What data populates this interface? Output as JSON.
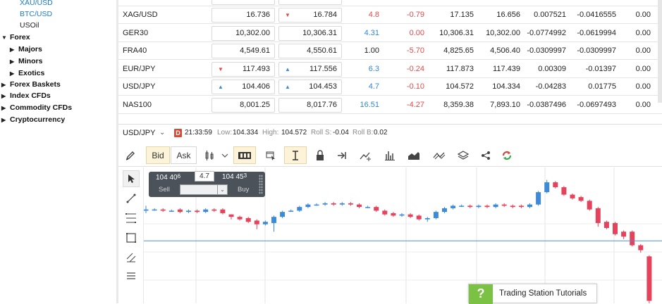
{
  "tree": {
    "leaves_top": [
      {
        "label": "XAU/USD",
        "blue": true
      },
      {
        "label": "BTC/USD",
        "blue": true
      },
      {
        "label": "USOil",
        "blue": false
      }
    ],
    "groups": [
      {
        "label": "Forex",
        "expanded": true,
        "level": 0
      },
      {
        "label": "Majors",
        "expanded": false,
        "level": 1
      },
      {
        "label": "Minors",
        "expanded": false,
        "level": 1
      },
      {
        "label": "Exotics",
        "expanded": false,
        "level": 1
      },
      {
        "label": "Forex Baskets",
        "expanded": false,
        "level": 0
      },
      {
        "label": "Index CFDs",
        "expanded": false,
        "level": 0
      },
      {
        "label": "Commodity CFDs",
        "expanded": false,
        "level": 0
      },
      {
        "label": "Cryptocurrency",
        "expanded": false,
        "level": 0
      }
    ]
  },
  "quotes": {
    "rows": [
      {
        "symbol": "XAG/USD",
        "sell": "16.736",
        "buy": "16.784",
        "sell_arrow": "",
        "buy_arrow": "down",
        "spread": "4.8",
        "spread_color": "neg",
        "change": "-0.79",
        "change_color": "neg",
        "high": "17.135",
        "low": "16.656",
        "c1": "0.007521",
        "c2": "-0.0416555",
        "c3": "0.00"
      },
      {
        "symbol": "GER30",
        "sell": "10,302.00",
        "buy": "10,306.31",
        "sell_arrow": "",
        "buy_arrow": "",
        "spread": "4.31",
        "spread_color": "pos",
        "change": "0.00",
        "change_color": "neg",
        "high": "10,306.31",
        "low": "10,302.00",
        "c1": "-0.0774992",
        "c2": "-0.0619994",
        "c3": "0.00"
      },
      {
        "symbol": "FRA40",
        "sell": "4,549.61",
        "buy": "4,550.61",
        "sell_arrow": "",
        "buy_arrow": "",
        "spread": "1.00",
        "spread_color": "blk",
        "change": "-5.70",
        "change_color": "neg",
        "high": "4,825.65",
        "low": "4,506.40",
        "c1": "-0.0309997",
        "c2": "-0.0309997",
        "c3": "0.00"
      },
      {
        "symbol": "EUR/JPY",
        "sell": "117.493",
        "buy": "117.556",
        "sell_arrow": "down",
        "buy_arrow": "up",
        "spread": "6.3",
        "spread_color": "pos",
        "change": "-0.24",
        "change_color": "neg",
        "high": "117.873",
        "low": "117.439",
        "c1": "0.00309",
        "c2": "-0.01397",
        "c3": "0.00"
      },
      {
        "symbol": "USD/JPY",
        "sell": "104.406",
        "buy": "104.453",
        "sell_arrow": "up",
        "buy_arrow": "up",
        "spread": "4.7",
        "spread_color": "pos",
        "change": "-0.10",
        "change_color": "neg",
        "high": "104.572",
        "low": "104.334",
        "c1": "-0.04283",
        "c2": "0.01775",
        "c3": "0.00"
      },
      {
        "symbol": "NAS100",
        "sell": "8,001.25",
        "buy": "8,017.76",
        "sell_arrow": "",
        "buy_arrow": "",
        "spread": "16.51",
        "spread_color": "pos",
        "change": "-4.27",
        "change_color": "neg",
        "high": "8,359.38",
        "low": "7,893.10",
        "c1": "-0.0387496",
        "c2": "-0.0697493",
        "c3": "0.00"
      }
    ]
  },
  "chart_header": {
    "symbol": "USD/JPY",
    "badge": "D",
    "time": "21:33:59",
    "low_label": "Low:",
    "low": "104.334",
    "high_label": "High:",
    "high": "104.572",
    "rolls_label": "Roll S:",
    "rolls": "-0.04",
    "rollb_label": "Roll B:",
    "rollb": "0.02"
  },
  "toolbar": {
    "bid_label": "Bid",
    "ask_label": "Ask"
  },
  "trade_widget": {
    "sell_main": "104 40",
    "sell_sup": "6",
    "sell_label": "Sell",
    "buy_main": "104 45",
    "buy_sup": "3",
    "buy_label": "Buy",
    "spread": "4.7"
  },
  "tutorial": {
    "icon": "?",
    "label": "Trading Station Tutorials"
  },
  "colors": {
    "up_candle": "#3d8bd8",
    "down_candle": "#e5425b",
    "accent_green": "#7bc144",
    "badge_red": "#d94a36"
  },
  "chart_data": {
    "type": "candlestick",
    "symbol": "USD/JPY",
    "ylim": [
      103.9,
      105.0
    ],
    "candles": [
      {
        "o": 104.65,
        "c": 104.66,
        "h": 104.69,
        "l": 104.63
      },
      {
        "o": 104.66,
        "c": 104.66,
        "h": 104.67,
        "l": 104.65
      },
      {
        "o": 104.66,
        "c": 104.65,
        "h": 104.67,
        "l": 104.64
      },
      {
        "o": 104.65,
        "c": 104.65,
        "h": 104.66,
        "l": 104.64
      },
      {
        "o": 104.66,
        "c": 104.64,
        "h": 104.67,
        "l": 104.63
      },
      {
        "o": 104.64,
        "c": 104.65,
        "h": 104.66,
        "l": 104.63
      },
      {
        "o": 104.65,
        "c": 104.64,
        "h": 104.66,
        "l": 104.63
      },
      {
        "o": 104.64,
        "c": 104.66,
        "h": 104.67,
        "l": 104.63
      },
      {
        "o": 104.66,
        "c": 104.65,
        "h": 104.67,
        "l": 104.64
      },
      {
        "o": 104.66,
        "c": 104.63,
        "h": 104.67,
        "l": 104.62
      },
      {
        "o": 104.62,
        "c": 104.6,
        "h": 104.62,
        "l": 104.58
      },
      {
        "o": 104.6,
        "c": 104.58,
        "h": 104.61,
        "l": 104.57
      },
      {
        "o": 104.59,
        "c": 104.56,
        "h": 104.6,
        "l": 104.55
      },
      {
        "o": 104.57,
        "c": 104.54,
        "h": 104.58,
        "l": 104.5
      },
      {
        "o": 104.54,
        "c": 104.56,
        "h": 104.57,
        "l": 104.53
      },
      {
        "o": 104.55,
        "c": 104.6,
        "h": 104.61,
        "l": 104.48
      },
      {
        "o": 104.6,
        "c": 104.64,
        "h": 104.65,
        "l": 104.59
      },
      {
        "o": 104.65,
        "c": 104.65,
        "h": 104.66,
        "l": 104.64
      },
      {
        "o": 104.65,
        "c": 104.68,
        "h": 104.69,
        "l": 104.64
      },
      {
        "o": 104.68,
        "c": 104.7,
        "h": 104.71,
        "l": 104.67
      },
      {
        "o": 104.7,
        "c": 104.7,
        "h": 104.71,
        "l": 104.69
      },
      {
        "o": 104.7,
        "c": 104.71,
        "h": 104.72,
        "l": 104.69
      },
      {
        "o": 104.71,
        "c": 104.7,
        "h": 104.72,
        "l": 104.69
      },
      {
        "o": 104.7,
        "c": 104.71,
        "h": 104.72,
        "l": 104.69
      },
      {
        "o": 104.71,
        "c": 104.7,
        "h": 104.72,
        "l": 104.69
      },
      {
        "o": 104.7,
        "c": 104.68,
        "h": 104.71,
        "l": 104.67
      },
      {
        "o": 104.68,
        "c": 104.68,
        "h": 104.69,
        "l": 104.67
      },
      {
        "o": 104.68,
        "c": 104.65,
        "h": 104.69,
        "l": 104.64
      },
      {
        "o": 104.65,
        "c": 104.62,
        "h": 104.66,
        "l": 104.61
      },
      {
        "o": 104.63,
        "c": 104.61,
        "h": 104.64,
        "l": 104.6
      },
      {
        "o": 104.61,
        "c": 104.62,
        "h": 104.63,
        "l": 104.6
      },
      {
        "o": 104.62,
        "c": 104.6,
        "h": 104.63,
        "l": 104.59
      },
      {
        "o": 104.61,
        "c": 104.58,
        "h": 104.62,
        "l": 104.57
      },
      {
        "o": 104.58,
        "c": 104.59,
        "h": 104.6,
        "l": 104.56
      },
      {
        "o": 104.59,
        "c": 104.64,
        "h": 104.65,
        "l": 104.58
      },
      {
        "o": 104.64,
        "c": 104.67,
        "h": 104.68,
        "l": 104.63
      },
      {
        "o": 104.67,
        "c": 104.69,
        "h": 104.7,
        "l": 104.66
      },
      {
        "o": 104.69,
        "c": 104.69,
        "h": 104.7,
        "l": 104.68
      },
      {
        "o": 104.69,
        "c": 104.68,
        "h": 104.7,
        "l": 104.67
      },
      {
        "o": 104.68,
        "c": 104.69,
        "h": 104.7,
        "l": 104.67
      },
      {
        "o": 104.69,
        "c": 104.68,
        "h": 104.7,
        "l": 104.67
      },
      {
        "o": 104.68,
        "c": 104.7,
        "h": 104.71,
        "l": 104.67
      },
      {
        "o": 104.7,
        "c": 104.69,
        "h": 104.71,
        "l": 104.68
      },
      {
        "o": 104.69,
        "c": 104.68,
        "h": 104.7,
        "l": 104.67
      },
      {
        "o": 104.69,
        "c": 104.68,
        "h": 104.7,
        "l": 104.67
      },
      {
        "o": 104.68,
        "c": 104.7,
        "h": 104.71,
        "l": 104.67
      },
      {
        "o": 104.7,
        "c": 104.8,
        "h": 104.81,
        "l": 104.69
      },
      {
        "o": 104.8,
        "c": 104.88,
        "h": 104.9,
        "l": 104.79
      },
      {
        "o": 104.88,
        "c": 104.84,
        "h": 104.89,
        "l": 104.83
      },
      {
        "o": 104.84,
        "c": 104.78,
        "h": 104.85,
        "l": 104.77
      },
      {
        "o": 104.78,
        "c": 104.75,
        "h": 104.79,
        "l": 104.74
      },
      {
        "o": 104.76,
        "c": 104.73,
        "h": 104.77,
        "l": 104.72
      },
      {
        "o": 104.73,
        "c": 104.66,
        "h": 104.74,
        "l": 104.65
      },
      {
        "o": 104.67,
        "c": 104.55,
        "h": 104.68,
        "l": 104.52
      },
      {
        "o": 104.56,
        "c": 104.51,
        "h": 104.57,
        "l": 104.5
      },
      {
        "o": 104.55,
        "c": 104.46,
        "h": 104.56,
        "l": 104.45
      },
      {
        "o": 104.48,
        "c": 104.44,
        "h": 104.49,
        "l": 104.42
      },
      {
        "o": 104.48,
        "c": 104.37,
        "h": 104.49,
        "l": 104.36
      },
      {
        "o": 104.37,
        "c": 104.33,
        "h": 104.38,
        "l": 104.31
      },
      {
        "o": 104.28,
        "c": 103.92,
        "h": 104.29,
        "l": 103.9
      }
    ],
    "price_line": 104.406
  }
}
